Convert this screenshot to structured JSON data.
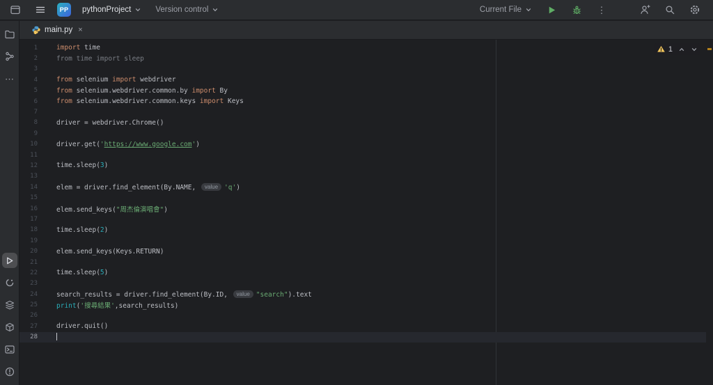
{
  "titlebar": {
    "project_badge": "PP",
    "project_name": "pythonProject",
    "vcs_label": "Version control",
    "run_config": "Current File"
  },
  "tab": {
    "label": "main.py"
  },
  "icons": {
    "kebab_glyph": "⋮",
    "more_glyph": "⋯",
    "close_glyph": "×"
  },
  "inspections": {
    "warnings": "1"
  },
  "colors": {
    "warning": "#f2c55c",
    "run_green": "#5fad65",
    "editor_background": "#1e1f22",
    "toolbar_background": "#2b2d30"
  },
  "editor": {
    "lines": [
      {
        "n": "1",
        "tokens": [
          [
            "kw",
            "import"
          ],
          [
            "pl",
            " time"
          ]
        ]
      },
      {
        "n": "2",
        "tokens": [
          [
            "gray",
            "from time import sleep"
          ]
        ]
      },
      {
        "n": "3",
        "tokens": []
      },
      {
        "n": "4",
        "tokens": [
          [
            "kw",
            "from"
          ],
          [
            "pl",
            " selenium "
          ],
          [
            "kw",
            "import"
          ],
          [
            "pl",
            " webdriver"
          ]
        ]
      },
      {
        "n": "5",
        "tokens": [
          [
            "kw",
            "from"
          ],
          [
            "pl",
            " selenium.webdriver.common.by "
          ],
          [
            "kw",
            "import"
          ],
          [
            "pl",
            " By"
          ]
        ]
      },
      {
        "n": "6",
        "tokens": [
          [
            "kw",
            "from"
          ],
          [
            "pl",
            " selenium.webdriver.common.keys "
          ],
          [
            "kw",
            "import"
          ],
          [
            "pl",
            " Keys"
          ]
        ]
      },
      {
        "n": "7",
        "tokens": []
      },
      {
        "n": "8",
        "tokens": [
          [
            "pl",
            "driver = webdriver.Chrome()"
          ]
        ]
      },
      {
        "n": "9",
        "tokens": []
      },
      {
        "n": "10",
        "tokens": [
          [
            "pl",
            "driver.get("
          ],
          [
            "str",
            "'"
          ],
          [
            "link",
            "https://www.google.com"
          ],
          [
            "str",
            "'"
          ],
          [
            "pl",
            ")"
          ]
        ]
      },
      {
        "n": "11",
        "tokens": []
      },
      {
        "n": "12",
        "tokens": [
          [
            "pl",
            "time.sleep("
          ],
          [
            "num",
            "3"
          ],
          [
            "pl",
            ")"
          ]
        ]
      },
      {
        "n": "13",
        "tokens": []
      },
      {
        "n": "14",
        "tokens": [
          [
            "pl",
            "elem = driver.find_element(By.NAME, "
          ],
          [
            "hint",
            "value"
          ],
          [
            "str",
            "'q'"
          ],
          [
            "pl",
            ")"
          ]
        ]
      },
      {
        "n": "15",
        "tokens": []
      },
      {
        "n": "16",
        "tokens": [
          [
            "pl",
            "elem.send_keys("
          ],
          [
            "str",
            "\"周杰倫演唱會\""
          ],
          [
            "pl",
            ")"
          ]
        ]
      },
      {
        "n": "17",
        "tokens": []
      },
      {
        "n": "18",
        "tokens": [
          [
            "pl",
            "time.sleep("
          ],
          [
            "num",
            "2"
          ],
          [
            "pl",
            ")"
          ]
        ]
      },
      {
        "n": "19",
        "tokens": []
      },
      {
        "n": "20",
        "tokens": [
          [
            "pl",
            "elem.send_keys(Keys.RETURN)"
          ]
        ]
      },
      {
        "n": "21",
        "tokens": []
      },
      {
        "n": "22",
        "tokens": [
          [
            "pl",
            "time.sleep("
          ],
          [
            "num",
            "5"
          ],
          [
            "pl",
            ")"
          ]
        ]
      },
      {
        "n": "23",
        "tokens": []
      },
      {
        "n": "24",
        "tokens": [
          [
            "pl",
            "search_results = driver.find_element(By.ID, "
          ],
          [
            "hint",
            "value"
          ],
          [
            "str",
            "\"search\""
          ],
          [
            "pl",
            ").text"
          ]
        ]
      },
      {
        "n": "25",
        "tokens": [
          [
            "bi",
            "print"
          ],
          [
            "pl",
            "("
          ],
          [
            "str",
            "'搜尋結果'"
          ],
          [
            "pl",
            ",search_results)"
          ]
        ]
      },
      {
        "n": "26",
        "tokens": []
      },
      {
        "n": "27",
        "tokens": [
          [
            "pl",
            "driver.quit()"
          ]
        ]
      },
      {
        "n": "28",
        "tokens": [],
        "caret": true,
        "current": true
      }
    ]
  }
}
